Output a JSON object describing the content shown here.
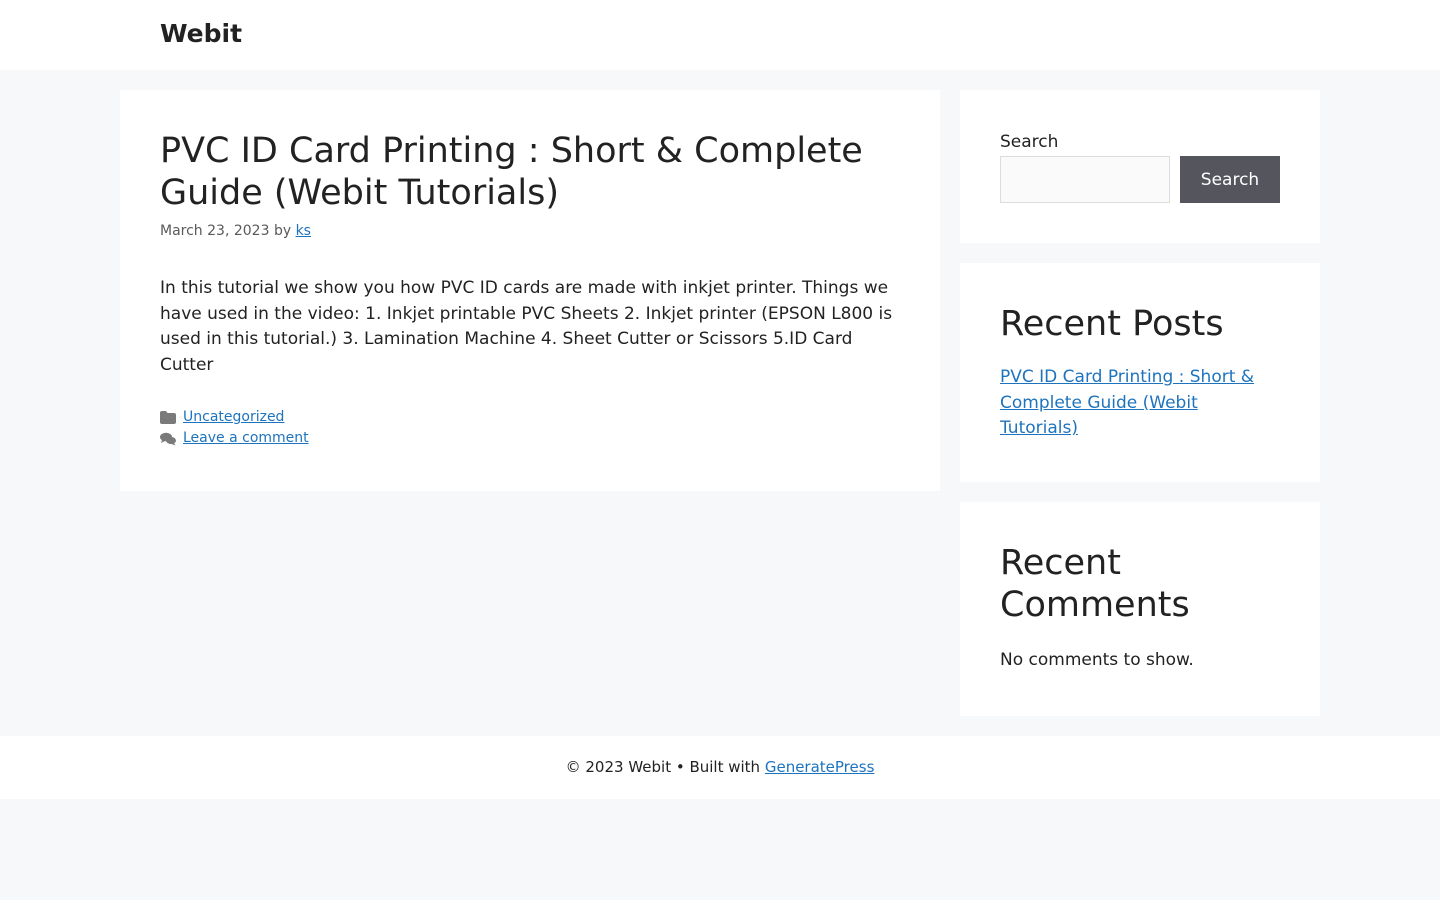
{
  "header": {
    "site_title": "Webit"
  },
  "article": {
    "title": "PVC ID Card Printing : Short & Complete Guide (Webit Tutorials)",
    "date": "March 23, 2023",
    "by": "by",
    "author": "ks",
    "content": "In this tutorial we show you how PVC ID cards are made with inkjet printer. Things we have used in the video: 1. Inkjet printable PVC Sheets 2. Inkjet printer (EPSON L800 is used in this tutorial.) 3. Lamination Machine 4. Sheet Cutter or Scissors 5.ID Card Cutter",
    "category_icon": "folder-icon",
    "category": "Uncategorized",
    "comment_icon": "comments-icon",
    "comment_link": "Leave a comment"
  },
  "sidebar": {
    "search": {
      "label": "Search",
      "value": "",
      "placeholder": "",
      "button_label": "Search"
    },
    "recent_posts": {
      "title": "Recent Posts",
      "items": [
        "PVC ID Card Printing : Short & Complete Guide (Webit Tutorials)"
      ]
    },
    "recent_comments": {
      "title": "Recent Comments",
      "empty_text": "No comments to show."
    }
  },
  "footer": {
    "text": "© 2023 Webit • Built with",
    "link": "GeneratePress"
  },
  "colors": {
    "background": "#f7f8f9",
    "panel": "#ffffff",
    "link": "#1e73be",
    "button": "#55555e",
    "text": "#222222"
  }
}
